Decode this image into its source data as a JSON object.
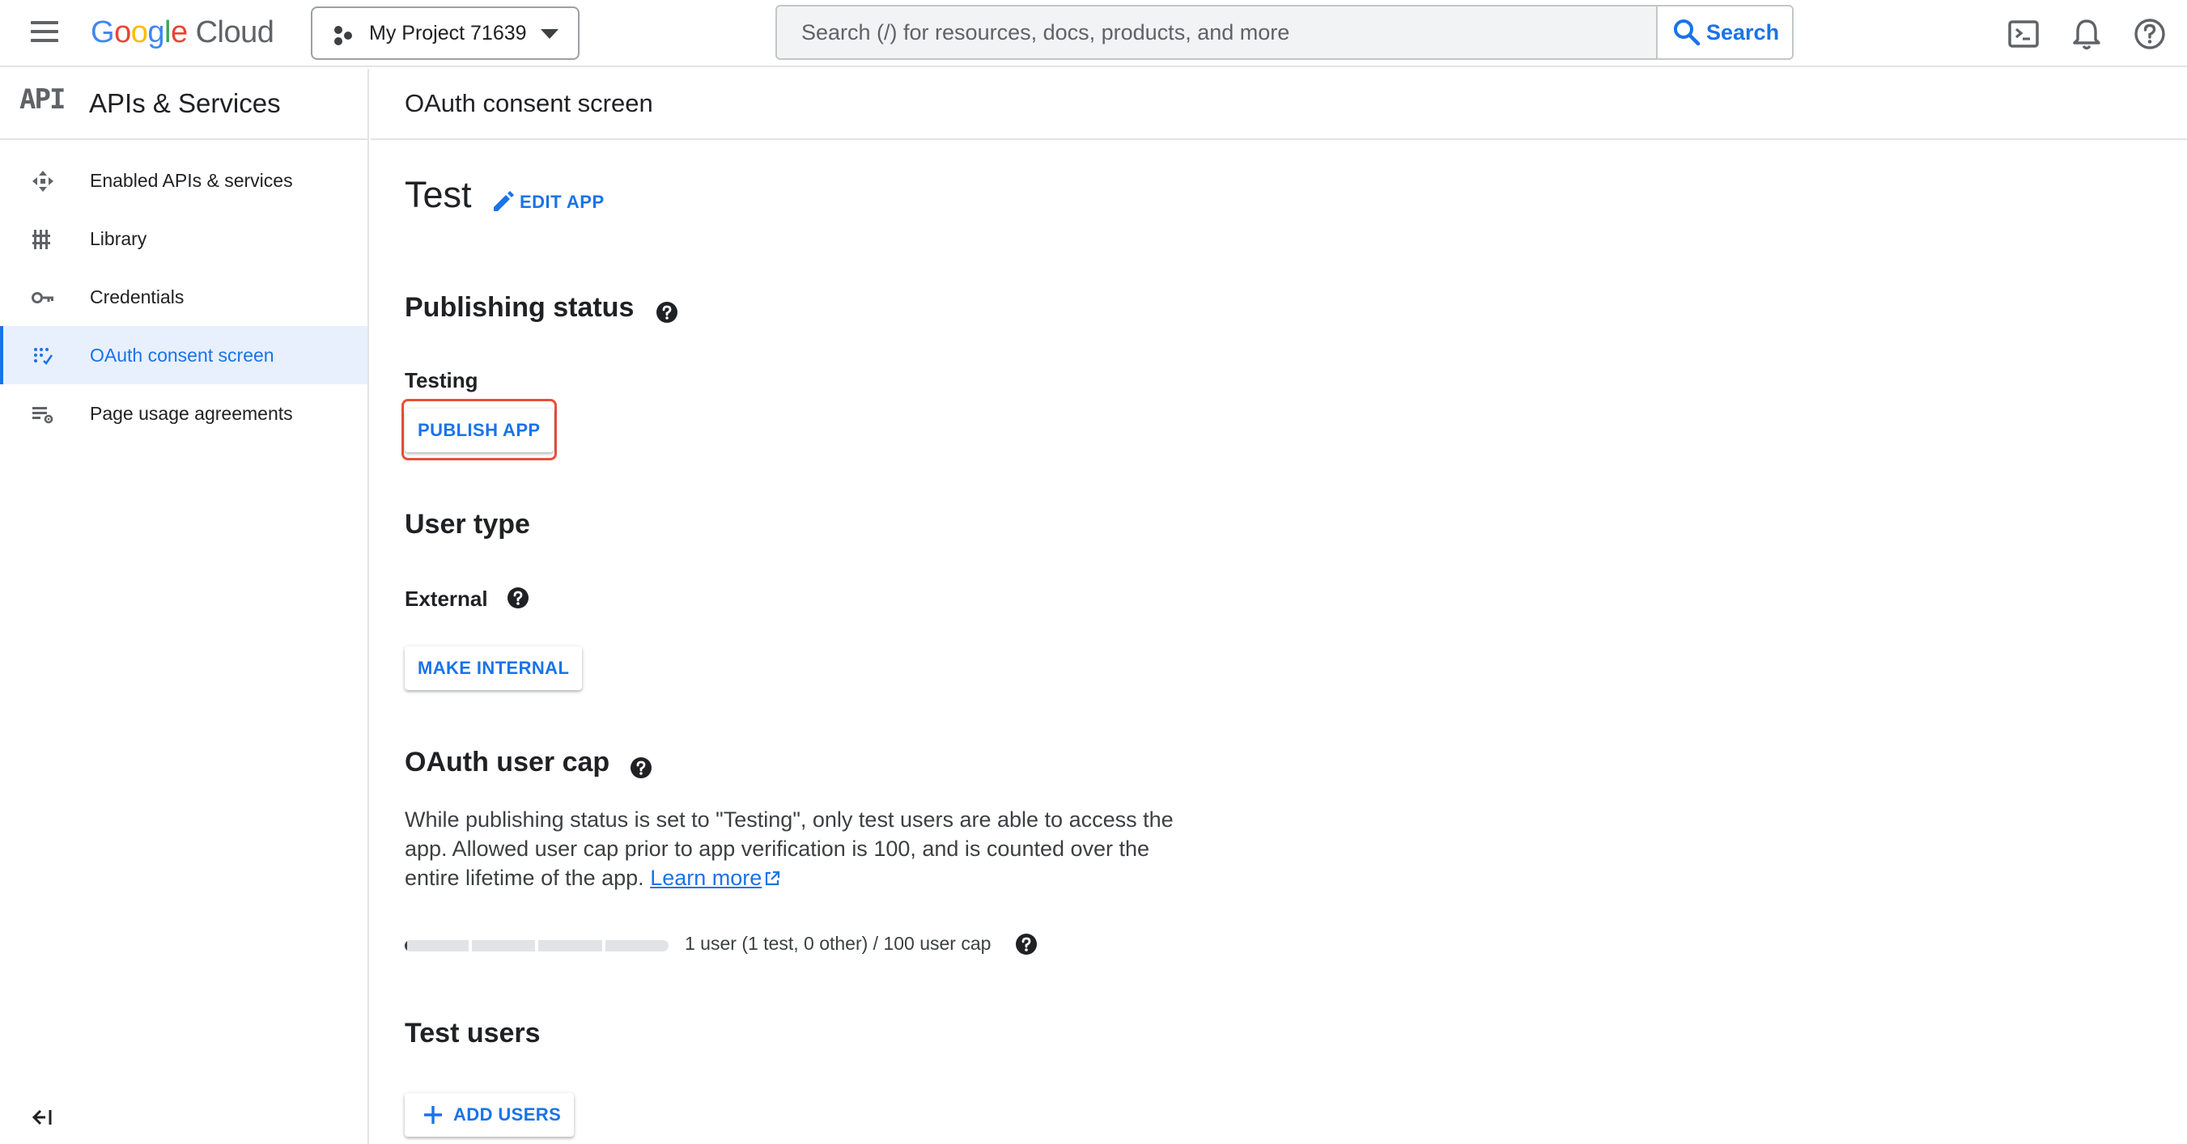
{
  "topbar": {
    "logo_google": "Google",
    "logo_cloud": "Cloud",
    "project_name": "My Project 71639",
    "search_placeholder": "Search (/) for resources, docs, products, and more",
    "search_button": "Search"
  },
  "sidebar": {
    "badge": "API",
    "title": "APIs & Services",
    "items": [
      {
        "label": "Enabled APIs & services",
        "icon": "apis-icon",
        "active": false
      },
      {
        "label": "Library",
        "icon": "library-icon",
        "active": false
      },
      {
        "label": "Credentials",
        "icon": "key-icon",
        "active": false
      },
      {
        "label": "OAuth consent screen",
        "icon": "consent-icon",
        "active": true
      },
      {
        "label": "Page usage agreements",
        "icon": "settings-list-icon",
        "active": false
      }
    ]
  },
  "page": {
    "title": "OAuth consent screen",
    "app_name": "Test",
    "edit_app": "EDIT APP",
    "publishing": {
      "title": "Publishing status",
      "status": "Testing",
      "button": "PUBLISH APP"
    },
    "user_type": {
      "title": "User type",
      "value": "External",
      "button": "MAKE INTERNAL"
    },
    "user_cap": {
      "title": "OAuth user cap",
      "description": "While publishing status is set to \"Testing\", only test users are able to access the app. Allowed user cap prior to app verification is 100, and is counted over the entire lifetime of the app.",
      "learn_more": "Learn more",
      "usage_text": "1 user (1 test, 0 other) / 100 user cap",
      "used": 1,
      "cap": 100
    },
    "test_users": {
      "title": "Test users",
      "button": "ADD USERS"
    }
  },
  "colors": {
    "accent": "#1a73e8",
    "highlight": "#e8503a",
    "active_bg": "#e8f0fe"
  }
}
